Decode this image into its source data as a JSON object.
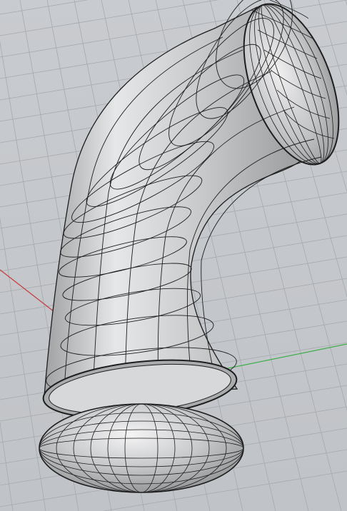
{
  "viewport": {
    "projection": "perspective",
    "display_mode": "shaded-wireframe",
    "background_color": "#c3c6ca",
    "grid_color": "#a6aaae",
    "x_axis_color": "#c8383a",
    "y_axis_color": "#3fae4a",
    "object": {
      "type": "curved tube surface with ellipsoid end caps",
      "surface_color": "#bfc1c3",
      "isocurve_color": "#1e1e1e"
    }
  }
}
